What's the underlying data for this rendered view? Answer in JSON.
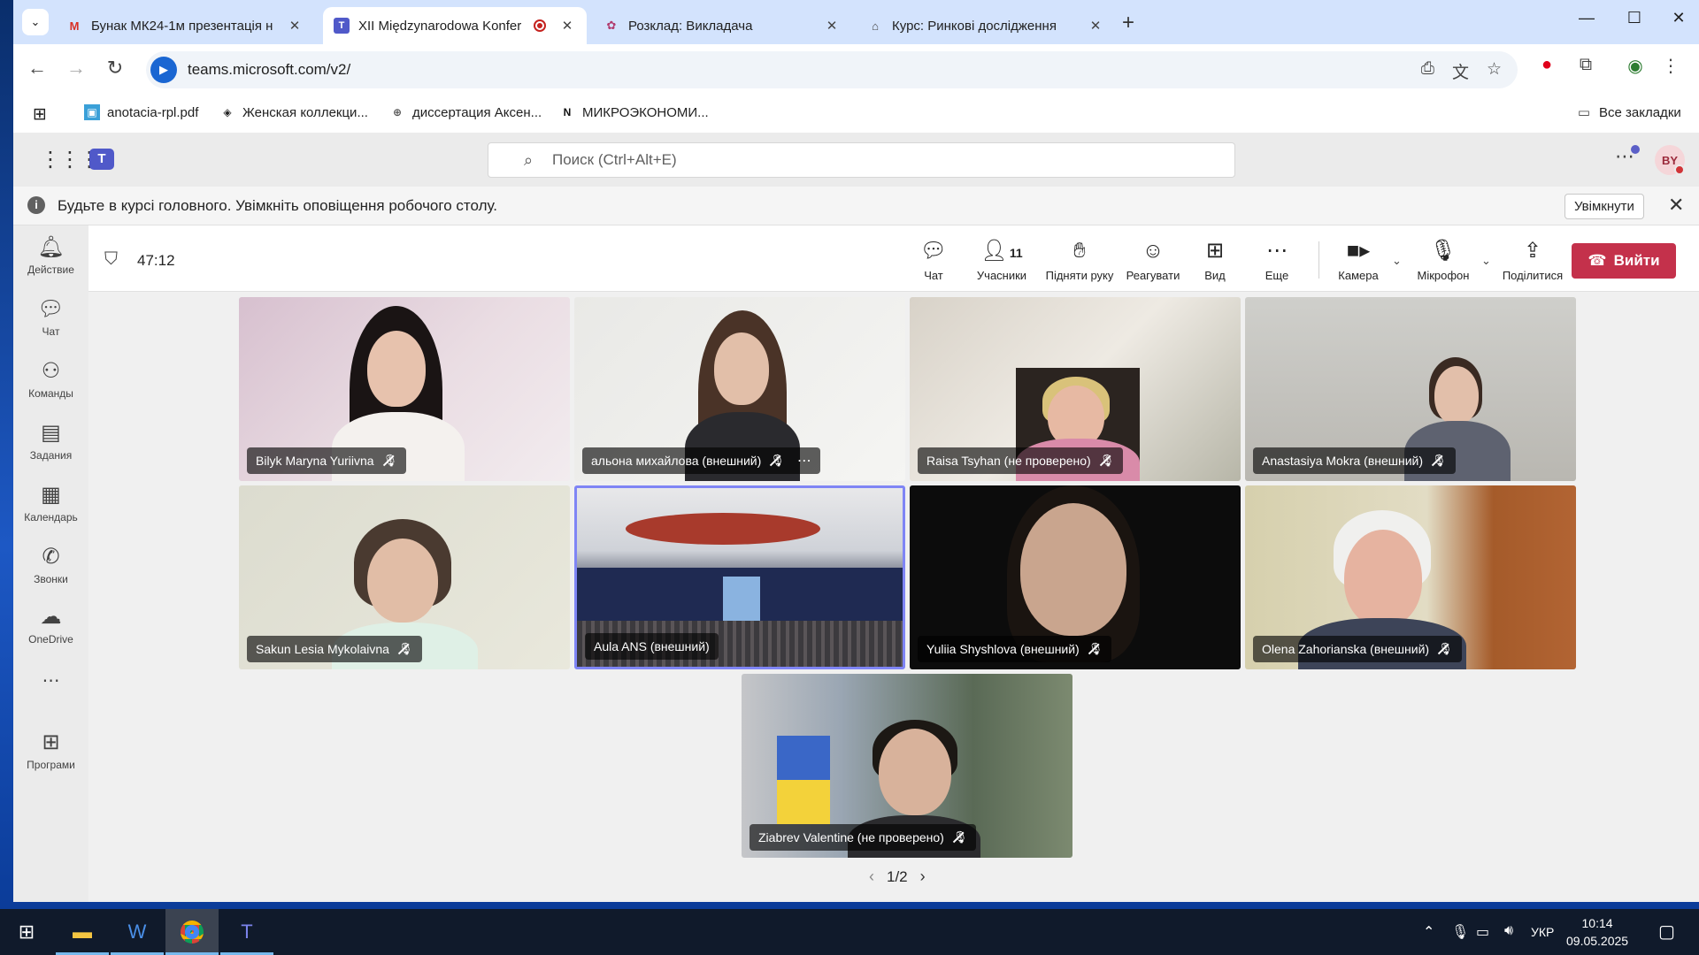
{
  "browser": {
    "tabs": [
      {
        "title": "Бунак МК24-1м презентація н",
        "favicon": "gmail-icon"
      },
      {
        "title": "XII Międzynarodowa Konfer",
        "favicon": "teams-icon",
        "active": true
      },
      {
        "title": "Розклад: Викладача",
        "favicon": "schedule-icon"
      },
      {
        "title": "Курс: Ринкові дослідження",
        "favicon": "course-icon"
      }
    ],
    "url": "teams.microsoft.com/v2/",
    "bookmarks": [
      {
        "label": "anotacia-rpl.pdf"
      },
      {
        "label": "Женская коллекци..."
      },
      {
        "label": "диссертация Аксен..."
      },
      {
        "label": "МИКРОЭКОНОМИ..."
      }
    ],
    "all_bookmarks": "Все закладки"
  },
  "teams": {
    "search_placeholder": "Поиск (Ctrl+Alt+E)",
    "avatar_initials": "BY",
    "notification": {
      "message": "Будьте в курсі головного. Увімкніть оповіщення робочого столу.",
      "enable_label": "Увімкнути"
    },
    "rail": [
      {
        "label": "Действие",
        "icon": "bell-icon"
      },
      {
        "label": "Чат",
        "icon": "chat-icon"
      },
      {
        "label": "Команды",
        "icon": "teams-icon"
      },
      {
        "label": "Задания",
        "icon": "assignments-icon"
      },
      {
        "label": "Календарь",
        "icon": "calendar-icon"
      },
      {
        "label": "Звонки",
        "icon": "phone-icon"
      },
      {
        "label": "OneDrive",
        "icon": "cloud-icon"
      },
      {
        "label": "Програми",
        "icon": "apps-icon"
      }
    ],
    "meeting": {
      "timer": "47:12",
      "participant_count": "11",
      "controls": {
        "chat": "Чат",
        "participants": "Учасники",
        "raise_hand": "Підняти руку",
        "react": "Реагувати",
        "view": "Вид",
        "more": "Еще",
        "camera": "Камера",
        "mic": "Мікрофон",
        "share": "Поділитися",
        "leave": "Вийти"
      },
      "participants": [
        {
          "name": "Bilyk Maryna Yuriivna"
        },
        {
          "name": "альона михайлова (внешний)"
        },
        {
          "name": "Raisa Tsyhan (не проверено)"
        },
        {
          "name": "Anastasiya Mokra (внешний)"
        },
        {
          "name": "Sakun Lesia Mykolaivna"
        },
        {
          "name": "Aula ANS (внешний)"
        },
        {
          "name": "Yuliia Shyshlova (внешний)"
        },
        {
          "name": "Olena Zahorianska (внешний)"
        },
        {
          "name": "Ziabrev Valentine (не проверено)"
        }
      ],
      "page": "1/2"
    }
  },
  "taskbar": {
    "language": "УКР",
    "time": "10:14",
    "date": "09.05.2025"
  }
}
